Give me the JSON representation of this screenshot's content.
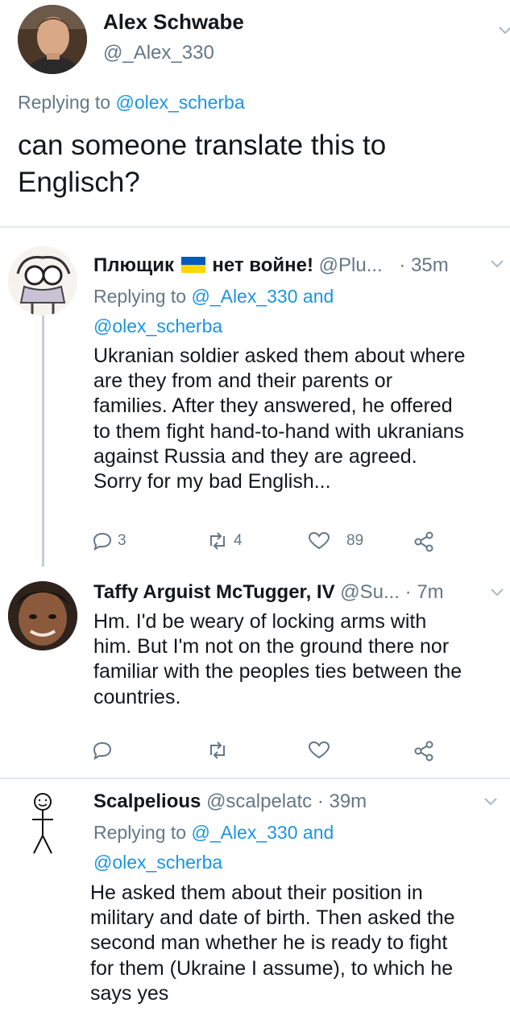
{
  "main_tweet": {
    "author_name": "Alex Schwabe",
    "author_handle": "@_Alex_330",
    "replying_prefix": "Replying to",
    "replying_to": "@olex_scherba",
    "text_line1": "can someone translate this to",
    "text_line2": "Englisch?"
  },
  "replies": [
    {
      "name_part1": "Плющик",
      "name_part2": "нет войне!",
      "handle": "@Plu...",
      "time": "· 35m",
      "replying_prefix": "Replying to",
      "replying_to_1": "@_Alex_330",
      "replying_and": "and",
      "replying_to_2": "@olex_scherba",
      "text_lines": [
        "Ukranian soldier asked them about where",
        "are they from and their parents or",
        "families. After they answered, he offered",
        "to them fight hand-to-hand with ukranians",
        "against Russia and they are agreed.",
        "Sorry for my bad English..."
      ],
      "replies_count": "3",
      "retweets_count": "4",
      "likes_count": "89"
    },
    {
      "name": "Taffy Arguist McTugger, IV",
      "handle": "@Su...",
      "time": "· 7m",
      "text_lines": [
        "Hm. I'd be weary of locking arms with",
        "him. But I'm not on the ground there nor",
        "familiar with the peoples ties between the",
        "countries."
      ]
    },
    {
      "name": "Scalpelious",
      "handle": "@scalpelatc",
      "time": "· 39m",
      "replying_prefix": "Replying to",
      "replying_to_1": "@_Alex_330",
      "replying_and": "and",
      "replying_to_2": "@olex_scherba",
      "text_lines": [
        "He asked them about their position in",
        "military and date of birth. Then asked the",
        "second man whether he is ready to fight",
        "for them (Ukraine I assume), to which he",
        "says yes"
      ]
    }
  ],
  "colors": {
    "link_blue": "#1b95e0",
    "secondary_grey": "#657786",
    "flag_blue": "#005bbb",
    "flag_yellow": "#ffd500"
  },
  "icons": [
    "chevron-down-icon",
    "reply-icon",
    "retweet-icon",
    "like-icon",
    "share-icon"
  ]
}
